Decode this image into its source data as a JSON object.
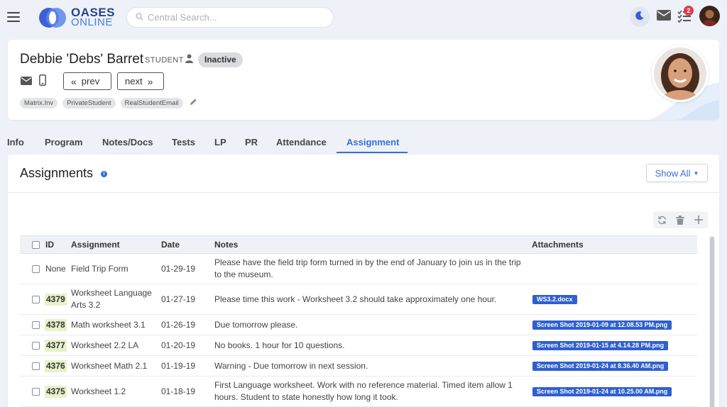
{
  "header": {
    "logo_line1": "OASES",
    "logo_line2": "ONLINE",
    "search_placeholder": "Central Search...",
    "notification_count": "2",
    "icons": [
      "hamburger-icon",
      "search-icon",
      "moon-icon",
      "mail-icon",
      "tasks-icon"
    ]
  },
  "profile": {
    "name": "Debbie 'Debs' Barret",
    "role": "STUDENT",
    "status": "Inactive",
    "prev_label": "prev",
    "next_label": "next",
    "tags": [
      "Matrix.Inv",
      "PrivateStudent",
      "RealStudentEmail"
    ]
  },
  "tabs": [
    {
      "label": "Info",
      "active": false
    },
    {
      "label": "Program",
      "active": false
    },
    {
      "label": "Notes/Docs",
      "active": false
    },
    {
      "label": "Tests",
      "active": false
    },
    {
      "label": "LP",
      "active": false
    },
    {
      "label": "PR",
      "active": false
    },
    {
      "label": "Attendance",
      "active": false
    },
    {
      "label": "Assignment",
      "active": true
    }
  ],
  "assignments": {
    "title": "Assignments",
    "info_glyph": "i",
    "show_all_label": "Show All",
    "columns": {
      "id": "ID",
      "assignment": "Assignment",
      "date": "Date",
      "notes": "Notes",
      "attachments": "Attachments"
    },
    "rows": [
      {
        "id": "None",
        "assignment": "Field Trip Form",
        "date": "01-29-19",
        "notes": "Please have the field trip form turned in by the end of January to join us in the trip to the museum.",
        "attachment": ""
      },
      {
        "id": "4379",
        "assignment": "Worksheet Language Arts 3.2",
        "date": "01-27-19",
        "notes": "Please time this work - Worksheet 3.2 should take approximately one hour.",
        "attachment": "WS3.2.docx"
      },
      {
        "id": "4378",
        "assignment": "Math worksheet 3.1",
        "date": "01-26-19",
        "notes": "Due tomorrow please.",
        "attachment": "Screen Shot 2019-01-09 at 12.08.53 PM.png"
      },
      {
        "id": "4377",
        "assignment": "Worksheet 2.2 LA",
        "date": "01-20-19",
        "notes": "No books. 1 hour for 10 questions.",
        "attachment": "Screen Shot 2019-01-15 at 4.14.28 PM.png"
      },
      {
        "id": "4376",
        "assignment": "Worksheet Math 2.1",
        "date": "01-19-19",
        "notes": "Warning - Due tomorrow in next session.",
        "attachment": "Screen Shot 2019-01-24 at 8.36.40 AM.png"
      },
      {
        "id": "4375",
        "assignment": "Worksheet 1.2",
        "date": "01-18-19",
        "notes": "First Language worksheet. Work with no reference material. Timed item allow 1 hours. Student to state honestly how long it took.",
        "attachment": "Screen Shot 2019-01-24 at 10.25.00 AM.png"
      }
    ]
  },
  "colors": {
    "accent": "#3a6fd6",
    "attachment_badge": "#2f5fd0",
    "id_highlight": "#e6f2c9",
    "notification": "#e23b4e"
  }
}
